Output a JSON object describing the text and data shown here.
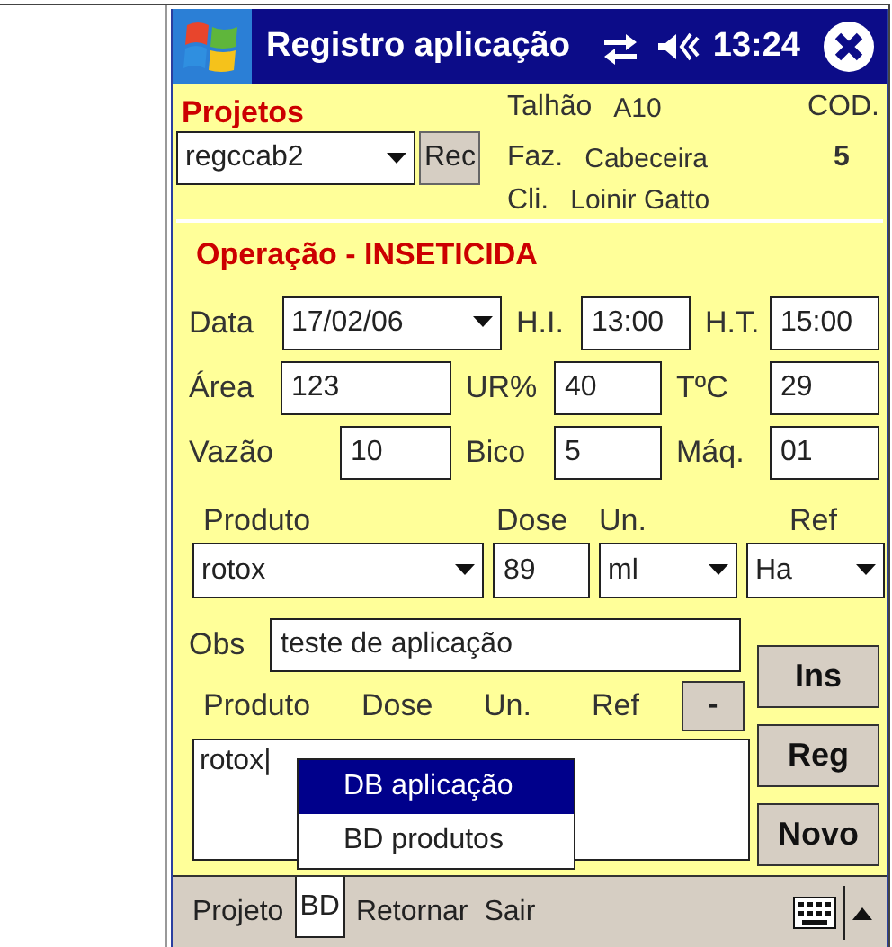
{
  "window": {
    "title": "Registro aplicação",
    "time": "13:24"
  },
  "project": {
    "label": "Projetos",
    "select": "regccab2",
    "button": "Rec",
    "code_label": "COD.",
    "code": "5",
    "fields": [
      {
        "label": "Talhão",
        "value": "A10"
      },
      {
        "label": "Faz.",
        "value": "Cabeceira"
      },
      {
        "label": "Cli.",
        "value": "Loinir Gatto"
      }
    ]
  },
  "operation": {
    "title": "Operação - INSETICIDA",
    "rows": [
      [
        {
          "label": "Data",
          "value": "17/02/06",
          "kind": "dropdown"
        },
        {
          "label": "H.I.",
          "value": "13:00",
          "kind": "text"
        },
        {
          "label": "H.T.",
          "value": "15:00",
          "kind": "text"
        }
      ],
      [
        {
          "label": "Área",
          "value": "123",
          "kind": "text"
        },
        {
          "label": "UR%",
          "value": "40",
          "kind": "text"
        },
        {
          "label": "TºC",
          "value": "29",
          "kind": "text"
        }
      ],
      [
        {
          "label": "Vazão",
          "value": "10",
          "kind": "text"
        },
        {
          "label": "Bico",
          "value": "5",
          "kind": "text"
        },
        {
          "label": "Máq.",
          "value": "01",
          "kind": "text"
        }
      ]
    ]
  },
  "product_headers": [
    "Produto",
    "Dose",
    "Un.",
    "Ref"
  ],
  "product_inputs": [
    {
      "value": "rotox",
      "kind": "dropdown"
    },
    {
      "value": "89",
      "kind": "text"
    },
    {
      "value": "ml",
      "kind": "dropdown"
    },
    {
      "value": "Ha",
      "kind": "dropdown"
    }
  ],
  "obs": {
    "label": "Obs",
    "value": "teste de aplicação"
  },
  "list_headers": [
    "Produto",
    "Dose",
    "Un.",
    "Ref"
  ],
  "remove_button": "-",
  "list_items": [
    "rotox|"
  ],
  "side_buttons": [
    "Ins",
    "Reg",
    "Novo"
  ],
  "menu_bar": [
    {
      "label": "Projeto",
      "selected": false
    },
    {
      "label": "BD",
      "selected": true
    },
    {
      "label": "Retornar",
      "selected": false
    },
    {
      "label": "Sair",
      "selected": false
    }
  ],
  "popup_menu": [
    {
      "label": "DB aplicação",
      "selected": true
    },
    {
      "label": "BD produtos",
      "selected": false
    }
  ]
}
